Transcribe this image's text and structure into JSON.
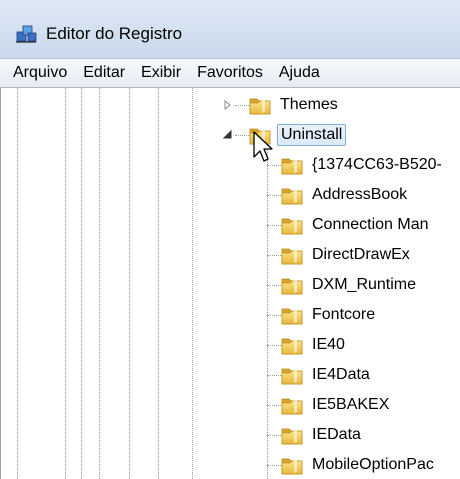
{
  "window": {
    "title": "Editor do Registro",
    "icon": "regedit-icon"
  },
  "menu": [
    "Arquivo",
    "Editar",
    "Exibir",
    "Favoritos",
    "Ajuda"
  ],
  "tree": {
    "themes": {
      "label": "Themes",
      "expanded": false
    },
    "uninstall": {
      "label": "Uninstall",
      "expanded": true,
      "selected": true
    },
    "children": [
      "{1374CC63-B520-",
      "AddressBook",
      "Connection Man",
      "DirectDrawEx",
      "DXM_Runtime",
      "Fontcore",
      "IE40",
      "IE4Data",
      "IE5BAKEX",
      "IEData",
      "MobileOptionPac"
    ]
  },
  "icons": {
    "folder": "folder-icon",
    "expand_collapsed": "expand-arrow-icon",
    "expand_open": "collapse-arrow-icon",
    "pointer": "mouse-pointer-icon"
  },
  "colors": {
    "folder": "#f2c94c",
    "selection_border": "#84acdd",
    "titlebar": "#dfe9f5"
  }
}
